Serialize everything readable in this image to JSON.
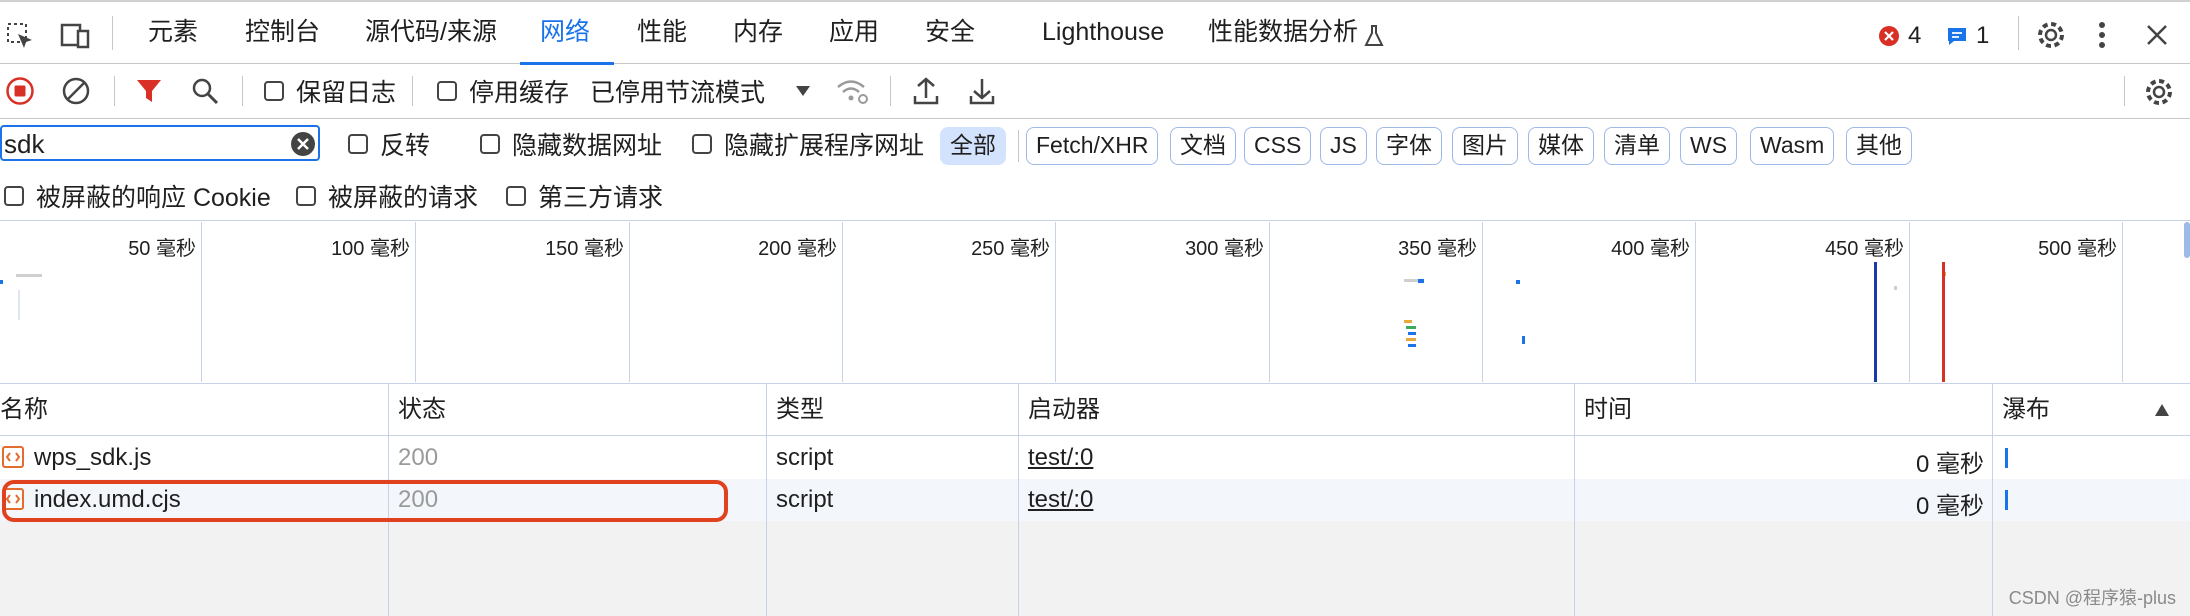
{
  "tabs": [
    {
      "label": "元素"
    },
    {
      "label": "控制台"
    },
    {
      "label": "源代码/来源"
    },
    {
      "label": "网络"
    },
    {
      "label": "性能"
    },
    {
      "label": "内存"
    },
    {
      "label": "应用"
    },
    {
      "label": "安全"
    },
    {
      "label": "Lighthouse"
    },
    {
      "label": "性能数据分析"
    }
  ],
  "counts": {
    "errors": "4",
    "messages": "1"
  },
  "toolbar": {
    "preserve_log": "保留日志",
    "disable_cache": "停用缓存",
    "throttle": "已停用节流模式"
  },
  "filter": {
    "value": "sdk",
    "invert": "反转",
    "hide_data_urls": "隐藏数据网址",
    "hide_extension_urls": "隐藏扩展程序网址",
    "types": [
      "全部",
      "Fetch/XHR",
      "文档",
      "CSS",
      "JS",
      "字体",
      "图片",
      "媒体",
      "清单",
      "WS",
      "Wasm",
      "其他"
    ],
    "blocked_cookies": "被屏蔽的响应 Cookie",
    "blocked_requests": "被屏蔽的请求",
    "third_party": "第三方请求"
  },
  "timeline": {
    "ticks": [
      "50 毫秒",
      "100 毫秒",
      "150 毫秒",
      "200 毫秒",
      "250 毫秒",
      "300 毫秒",
      "350 毫秒",
      "400 毫秒",
      "450 毫秒",
      "500 毫秒"
    ],
    "dom_content_loaded_ms": 450,
    "load_ms": 460,
    "colors": {
      "dcl": "#1a3aa8",
      "load": "#d93025"
    }
  },
  "table": {
    "headers": {
      "name": "名称",
      "status": "状态",
      "type": "类型",
      "initiator": "启动器",
      "time": "时间",
      "waterfall": "瀑布"
    },
    "rows": [
      {
        "name": "wps_sdk.js",
        "status": "200",
        "type": "script",
        "initiator": "test/:0",
        "time": "0 毫秒"
      },
      {
        "name": "index.umd.cjs",
        "status": "200",
        "type": "script",
        "initiator": "test/:0",
        "time": "0 毫秒"
      }
    ]
  },
  "watermark": "CSDN @程序猿-plus",
  "colors": {
    "accent": "#1a73e8",
    "error": "#d93025",
    "highlight": "#e0421f"
  }
}
